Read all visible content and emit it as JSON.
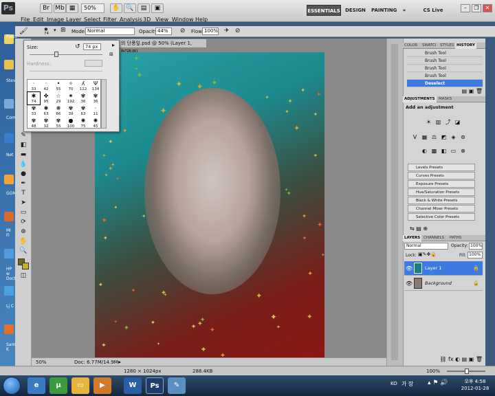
{
  "app": {
    "logo": "Ps",
    "zoom": "50%",
    "workspaces": [
      "ESSENTIALS",
      "DESIGN",
      "PAINTING"
    ],
    "cs_live": "CS Live"
  },
  "menu": [
    "File",
    "Edit",
    "Image",
    "Layer",
    "Select",
    "Filter",
    "Analysis",
    "3D",
    "View",
    "Window",
    "Help"
  ],
  "options": {
    "brush_size": "74",
    "mode_label": "Mode:",
    "mode_value": "Normal",
    "opacity_label": "Opacity:",
    "opacity_value": "44%",
    "flow_label": "Flow:",
    "flow_value": "100%"
  },
  "document": {
    "tab_title": "의 단풍잎.psd @ 50% (Layer 1, RGB/8)",
    "zoom": "50%",
    "doc_size": "Doc: 6.77M/14.9M"
  },
  "brush_picker": {
    "size_label": "Size:",
    "size_value": "74 px",
    "hardness_label": "Hardness:",
    "brushes": [
      "33",
      "42",
      "55",
      "70",
      "112",
      "134",
      "74",
      "95",
      "29",
      "192",
      "36",
      "36",
      "33",
      "63",
      "66",
      "39",
      "63",
      "11",
      "48",
      "32",
      "55",
      "100",
      "75",
      "45"
    ]
  },
  "history": {
    "tabs": [
      "COLOR",
      "SWATCI",
      "STYLES",
      "HISTORY"
    ],
    "items": [
      "Brush Tool",
      "Brush Tool",
      "Brush Tool",
      "Brush Tool",
      "Deselect"
    ]
  },
  "adjustments": {
    "tabs": [
      "ADJUSTMENTS",
      "MASKS"
    ],
    "heading": "Add an adjustment",
    "presets": [
      "Levels Presets",
      "Curves Presets",
      "Exposure Presets",
      "Hue/Saturation Presets",
      "Black & White Presets",
      "Channel Mixer Presets",
      "Selective Color Presets"
    ]
  },
  "layers": {
    "tabs": [
      "LAYERS",
      "CHANNELS",
      "PATHS"
    ],
    "blend_mode": "Normal",
    "opacity_label": "Opacity:",
    "opacity_value": "100%",
    "lock_label": "Lock:",
    "fill_label": "Fill:",
    "fill_value": "100%",
    "items": [
      "Layer 1",
      "Background"
    ]
  },
  "statusbar": {
    "dimensions": "1280 × 1024px",
    "file_size": "288.4KB",
    "zoom": "100%"
  },
  "desktop_labels": [
    "Paste",
    "Stev",
    "Com",
    "Net",
    "GOM",
    "Mi Fi",
    "HP w Doctor",
    "Lj C",
    "Sam K"
  ],
  "taskbar": {
    "lang": "KO",
    "ime": "가 장",
    "clock_line1": "오후 4:58",
    "clock_line2": "2012-01-28"
  },
  "colors": {
    "accent": "#3d7be0",
    "workspace": "#898989",
    "taskbar": "#14273c"
  }
}
